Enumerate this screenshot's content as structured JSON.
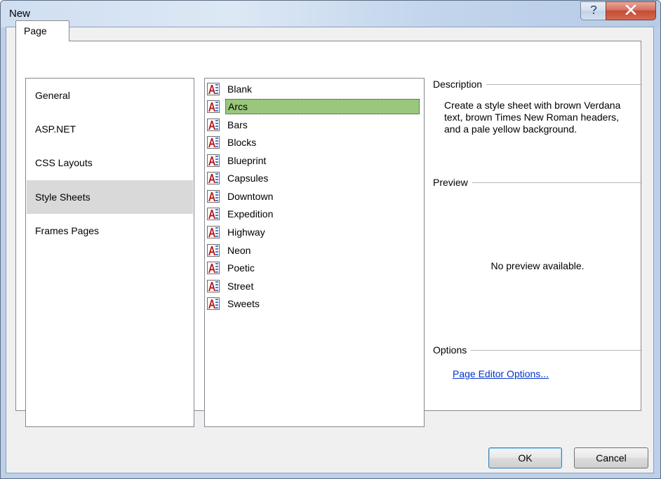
{
  "window": {
    "title": "New",
    "help_icon": "help-icon",
    "close_icon": "close-icon"
  },
  "tabs": [
    {
      "label": "Page"
    }
  ],
  "categories": [
    {
      "label": "General"
    },
    {
      "label": "ASP.NET"
    },
    {
      "label": "CSS Layouts"
    },
    {
      "label": "Style Sheets",
      "selected": true
    },
    {
      "label": "Frames Pages"
    }
  ],
  "templates": [
    {
      "label": "Blank"
    },
    {
      "label": "Arcs",
      "selected": true
    },
    {
      "label": "Bars"
    },
    {
      "label": "Blocks"
    },
    {
      "label": "Blueprint"
    },
    {
      "label": "Capsules"
    },
    {
      "label": "Downtown"
    },
    {
      "label": "Expedition"
    },
    {
      "label": "Highway"
    },
    {
      "label": "Neon"
    },
    {
      "label": "Poetic"
    },
    {
      "label": "Street"
    },
    {
      "label": "Sweets"
    }
  ],
  "template_icon": "css-file-icon",
  "description": {
    "heading": "Description",
    "text": "Create a style sheet with brown Verdana text, brown Times New Roman headers, and a pale yellow background."
  },
  "preview": {
    "heading": "Preview",
    "text": "No preview available."
  },
  "options": {
    "heading": "Options",
    "link": "Page Editor Options..."
  },
  "buttons": {
    "ok": "OK",
    "cancel": "Cancel"
  },
  "colors": {
    "selection_green": "#99c77b",
    "category_selected": "#d9d9d9",
    "link_blue": "#0033cc",
    "close_red": "#c74b35"
  }
}
